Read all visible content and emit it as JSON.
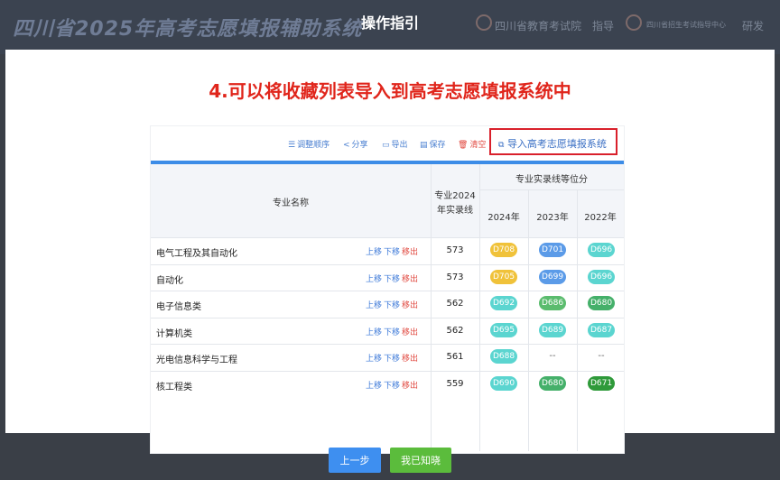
{
  "background": {
    "app_title": "四川省2025年高考志愿填报辅助系统",
    "guide_label": "指导",
    "develop_label": "研发",
    "org1_name": "四川省教育考试院",
    "org2_name": "四川省招生考试指导中心"
  },
  "modal": {
    "title": "操作指引",
    "heading": "4.可以将收藏列表导入到高考志愿填报系统中"
  },
  "toolbar": {
    "adjust_order": "调整顺序",
    "share": "分享",
    "export": "导出",
    "save": "保存",
    "clear": "清空",
    "import_system": "导入高考志愿填报系统"
  },
  "table": {
    "col_major": "专业名称",
    "col_score_line1": "专业2024",
    "col_score_line2": "年实录线",
    "col_rank_group": "专业实录线等位分",
    "years": [
      "2024年",
      "2023年",
      "2022年"
    ],
    "action_up": "上移",
    "action_down": "下移",
    "action_remove": "移出",
    "empty": "--",
    "rows": [
      {
        "name": "电气工程及其自动化",
        "score": "573",
        "ranks": [
          "D708",
          "D701",
          "D696"
        ],
        "colors": [
          "#f0c23a",
          "#5b9be8",
          "#5bd5d0"
        ]
      },
      {
        "name": "自动化",
        "score": "573",
        "ranks": [
          "D705",
          "D699",
          "D696"
        ],
        "colors": [
          "#f0c23a",
          "#5b9be8",
          "#5bd5d0"
        ]
      },
      {
        "name": "电子信息类",
        "score": "562",
        "ranks": [
          "D692",
          "D686",
          "D680"
        ],
        "colors": [
          "#5bd5d0",
          "#5bbc6e",
          "#45b06a"
        ]
      },
      {
        "name": "计算机类",
        "score": "562",
        "ranks": [
          "D695",
          "D689",
          "D687"
        ],
        "colors": [
          "#5bd5d0",
          "#5bd5d0",
          "#5bd5d0"
        ]
      },
      {
        "name": "光电信息科学与工程",
        "score": "561",
        "ranks": [
          "D688",
          "",
          ""
        ],
        "colors": [
          "#5bd5d0",
          "",
          ""
        ]
      },
      {
        "name": "核工程类",
        "score": "559",
        "ranks": [
          "D690",
          "D680",
          "D671"
        ],
        "colors": [
          "#5bd5d0",
          "#45b06a",
          "#2f9a3a"
        ]
      }
    ]
  },
  "buttons": {
    "prev": "上一步",
    "ok": "我已知晓"
  }
}
